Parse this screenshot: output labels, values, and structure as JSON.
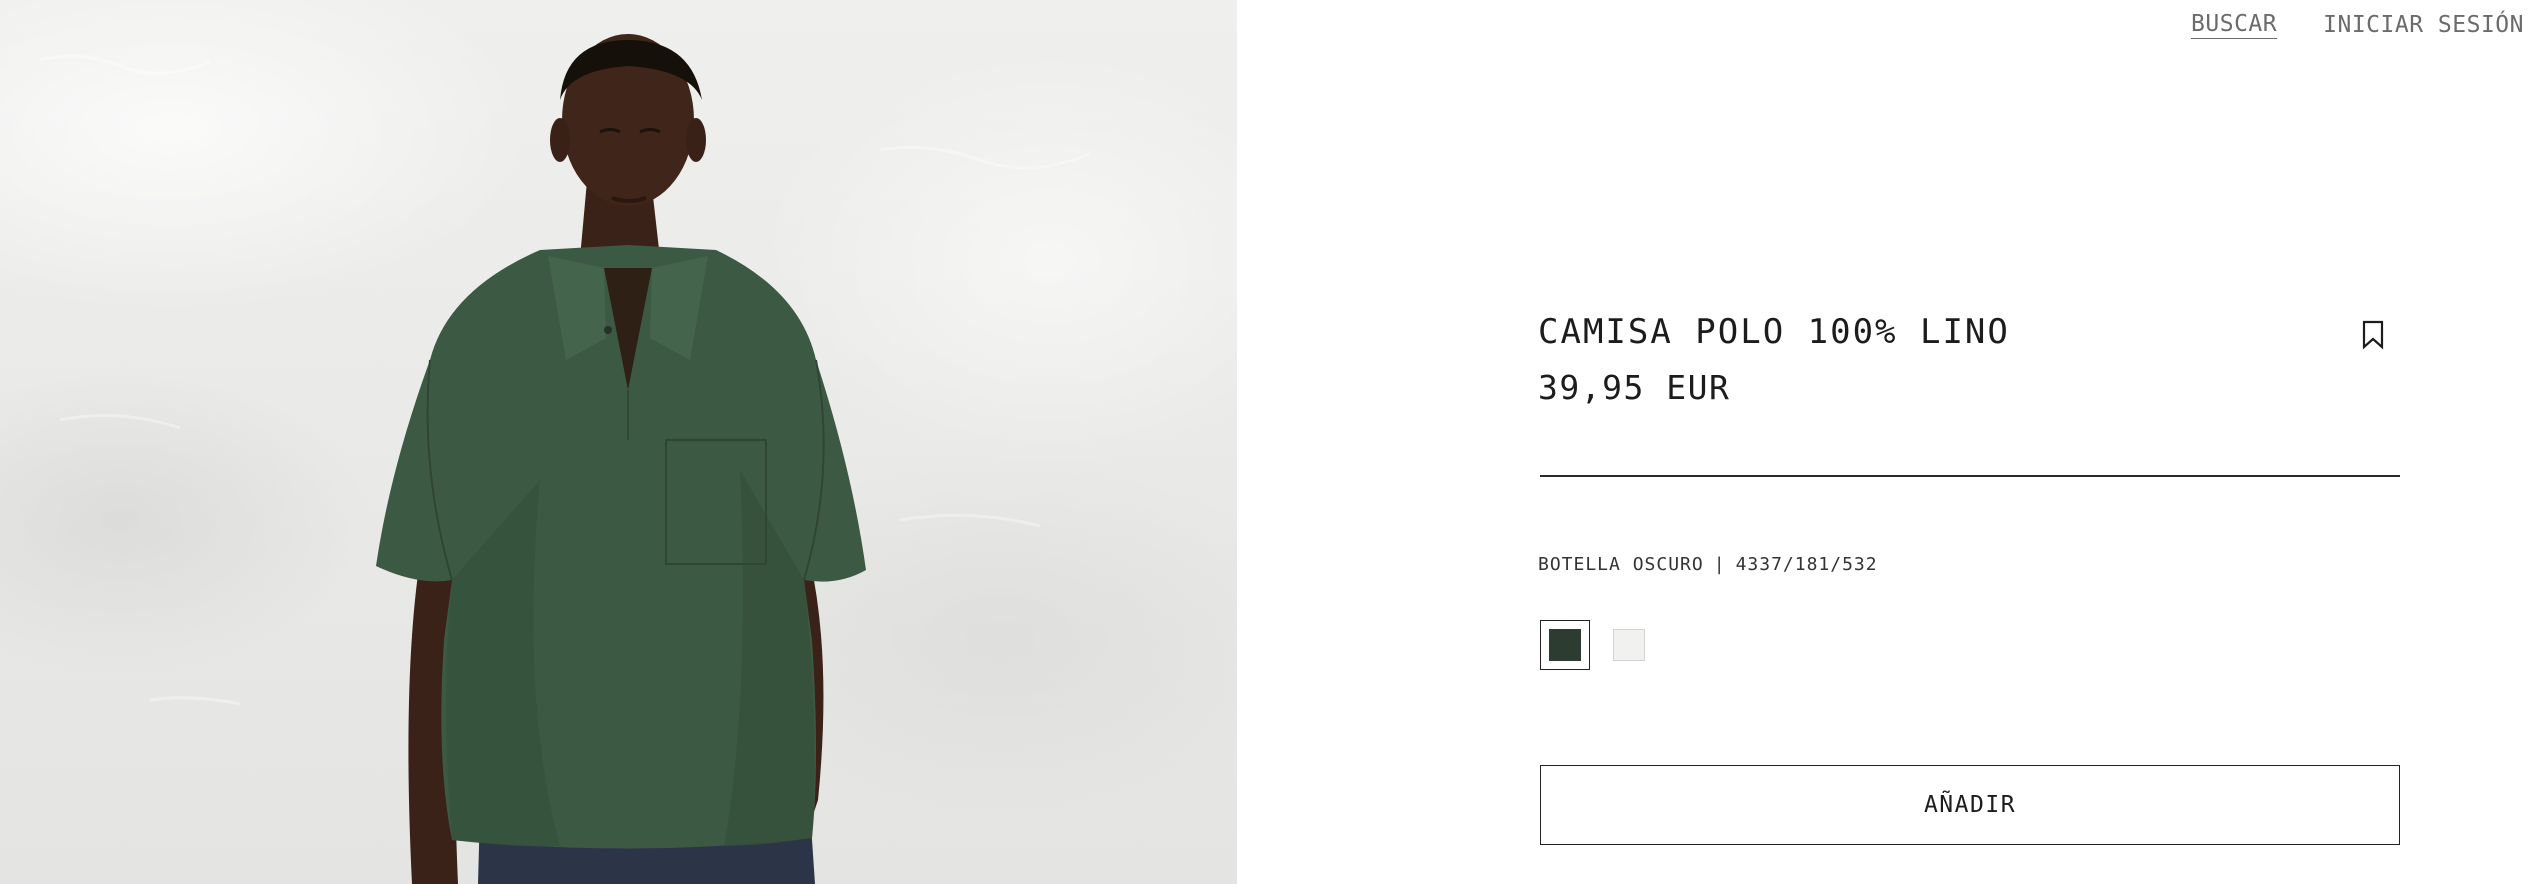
{
  "nav": {
    "search_label": "BUSCAR",
    "login_label": "INICIAR SESIÓN"
  },
  "product": {
    "name": "CAMISA POLO 100% LINO",
    "price": "39,95 EUR",
    "color_name": "BOTELLA OSCURO",
    "separator": "|",
    "reference": "4337/181/532",
    "swatches": [
      {
        "name": "Botella oscuro",
        "color": "#2d3c31",
        "selected": true
      },
      {
        "name": "Blanco",
        "color": "#f1f1ef",
        "selected": false
      }
    ],
    "add_label": "AÑADIR"
  },
  "icons": {
    "bookmark": "bookmark-icon"
  }
}
